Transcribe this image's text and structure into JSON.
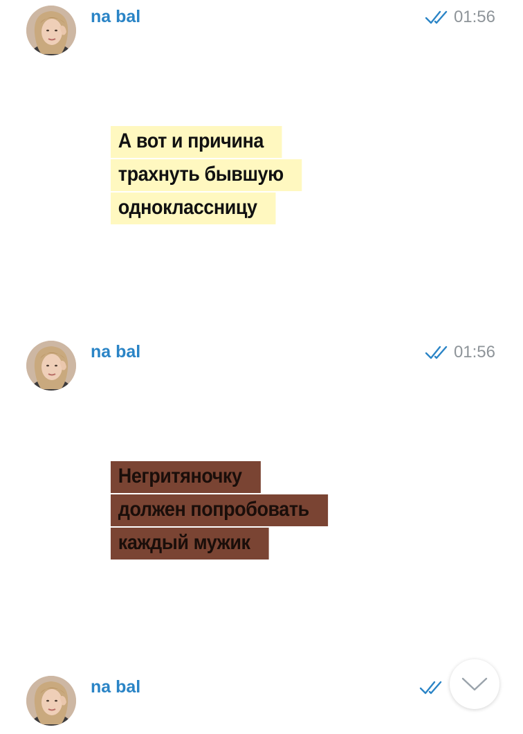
{
  "messages": [
    {
      "sender": "na bal",
      "time": "01:56",
      "caption_color": "#fff8c0",
      "caption_lines": [
        "А вот и причина",
        "трахнуть бывшую",
        "одноклассницу"
      ]
    },
    {
      "sender": "na bal",
      "time": "01:56",
      "caption_color": "#7a4433",
      "caption_lines": [
        "Негритяночку",
        "должен попробовать",
        "каждый мужик"
      ]
    },
    {
      "sender": "na bal",
      "time": "",
      "caption_lines": []
    }
  ],
  "icons": {
    "read_status": "double-check-icon",
    "scroll_down": "chevron-down-icon",
    "avatar": "avatar"
  },
  "colors": {
    "sender": "#2a84c6",
    "ticks": "#2a84c6",
    "time": "#8e9499"
  }
}
